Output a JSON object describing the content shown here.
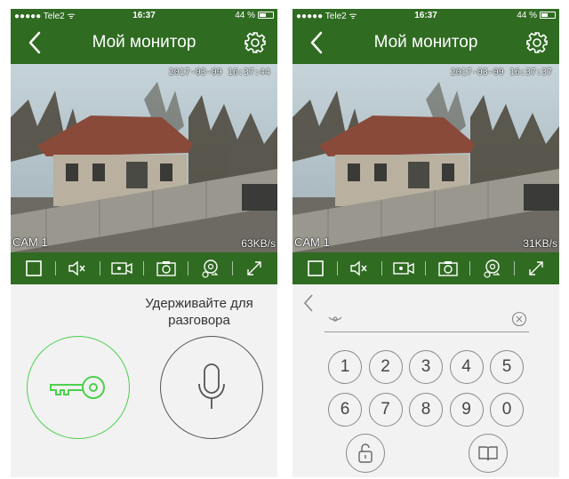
{
  "left": {
    "status": {
      "carrier": "●●●●● Tele2 ᯤ",
      "time": "16:37",
      "battery": "44 %"
    },
    "nav": {
      "title": "Мой монитор"
    },
    "video": {
      "timestamp": "2017-03-09 16:37:44",
      "camera": "CAM 1",
      "bitrate": "63KB/s"
    },
    "talk_hint": "Удерживайте для разговора"
  },
  "right": {
    "status": {
      "carrier": "●●●●● Tele2 ᯤ",
      "time": "16:37",
      "battery": "44 %"
    },
    "nav": {
      "title": "Мой монитор"
    },
    "video": {
      "timestamp": "2017-03-09 16:37:37",
      "camera": "CAM 1",
      "bitrate": "31KB/s"
    },
    "keypad": {
      "row1": [
        "1",
        "2",
        "3",
        "4",
        "5"
      ],
      "row2": [
        "6",
        "7",
        "8",
        "9",
        "0"
      ]
    }
  },
  "toolbar_icons": [
    "fullscreen-square-icon",
    "mute-icon",
    "record-video-icon",
    "snapshot-icon",
    "playback-icon",
    "expand-icon"
  ],
  "colors": {
    "brand_green": "#2f6b21",
    "unlock_green": "#4cd04c"
  }
}
